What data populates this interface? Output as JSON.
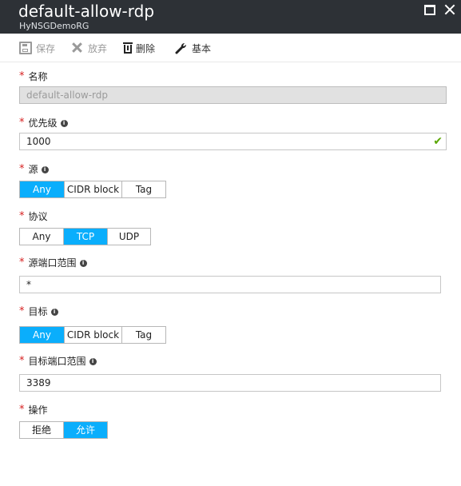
{
  "titlebar": {
    "title": "default-allow-rdp",
    "subtitle": "HyNSGDemoRG"
  },
  "toolbar": {
    "save": "保存",
    "discard": "放弃",
    "delete": "删除",
    "basic": "基本"
  },
  "form": {
    "required_mark": "*",
    "info_mark": "i",
    "name": {
      "label": "名称",
      "value": "default-allow-rdp"
    },
    "priority": {
      "label": "优先级",
      "value": "1000"
    },
    "source": {
      "label": "源",
      "options": [
        "Any",
        "CIDR block",
        "Tag"
      ],
      "selected": "Any"
    },
    "protocol": {
      "label": "协议",
      "options": [
        "Any",
        "TCP",
        "UDP"
      ],
      "selected": "TCP"
    },
    "source_port_range": {
      "label": "源端口范围",
      "value": "*"
    },
    "destination": {
      "label": "目标",
      "options": [
        "Any",
        "CIDR block",
        "Tag"
      ],
      "selected": "Any"
    },
    "destination_port_range": {
      "label": "目标端口范围",
      "value": "3389"
    },
    "action": {
      "label": "操作",
      "options": [
        "拒绝",
        "允许"
      ],
      "selected": "允许"
    }
  },
  "colors": {
    "titlebar": "#2d3136",
    "selected": "#0aaefc",
    "required": "#d71f1f",
    "valid_check": "#5aa700"
  },
  "icons": {
    "save": "floppy-disk-icon",
    "discard": "close-x-icon",
    "delete": "trash-icon",
    "basic": "wrench-icon",
    "valid": "checkmark-icon",
    "window_maximize": "maximize-icon",
    "window_close": "close-icon"
  }
}
